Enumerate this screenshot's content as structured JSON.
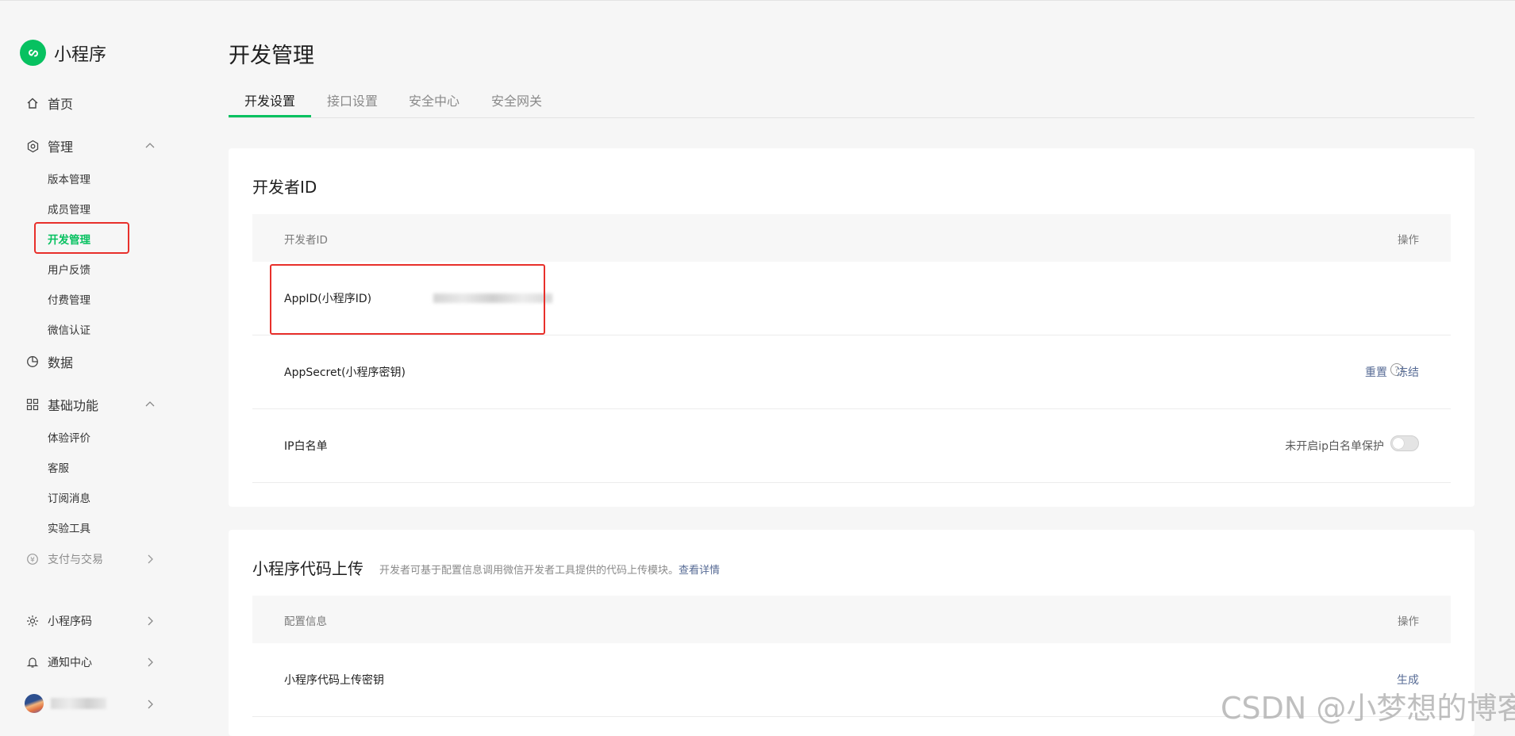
{
  "brand": {
    "name": "小程序"
  },
  "sidebar": {
    "home": "首页",
    "manage": "管理",
    "manage_items": [
      "版本管理",
      "成员管理",
      "开发管理",
      "用户反馈",
      "付费管理",
      "微信认证"
    ],
    "data": "数据",
    "basic": "基础功能",
    "basic_items": [
      "体验评价",
      "客服",
      "订阅消息",
      "实验工具"
    ],
    "payment": "支付与交易",
    "qrcode": "小程序码",
    "notify": "通知中心"
  },
  "main": {
    "title": "开发管理",
    "tabs": [
      "开发设置",
      "接口设置",
      "安全中心",
      "安全网关"
    ]
  },
  "dev_id_card": {
    "title": "开发者ID",
    "header": {
      "col1": "开发者ID",
      "col2": "操作"
    },
    "rows": {
      "appid": {
        "label": "AppID(小程序ID)"
      },
      "secret": {
        "label": "AppSecret(小程序密钥)",
        "reset": "重置",
        "freeze": "冻结"
      },
      "ip": {
        "label": "IP白名单",
        "status": "未开启ip白名单保护"
      }
    }
  },
  "upload_card": {
    "title": "小程序代码上传",
    "desc": "开发者可基于配置信息调用微信开发者工具提供的代码上传模块。",
    "desc_link": "查看详情",
    "header": {
      "col1": "配置信息",
      "col2": "操作"
    },
    "row": {
      "label": "小程序代码上传密钥",
      "action": "生成"
    }
  },
  "watermark": "CSDN @小梦想的博客",
  "colors": {
    "accent": "#07c160",
    "link": "#576b95",
    "highlight": "#e8302b"
  },
  "icons": [
    "home-icon",
    "settings-icon",
    "chart-icon",
    "grid-icon",
    "yen-icon",
    "sun-icon",
    "bell-icon",
    "chevron-up-icon",
    "chevron-right-icon",
    "help-icon"
  ]
}
